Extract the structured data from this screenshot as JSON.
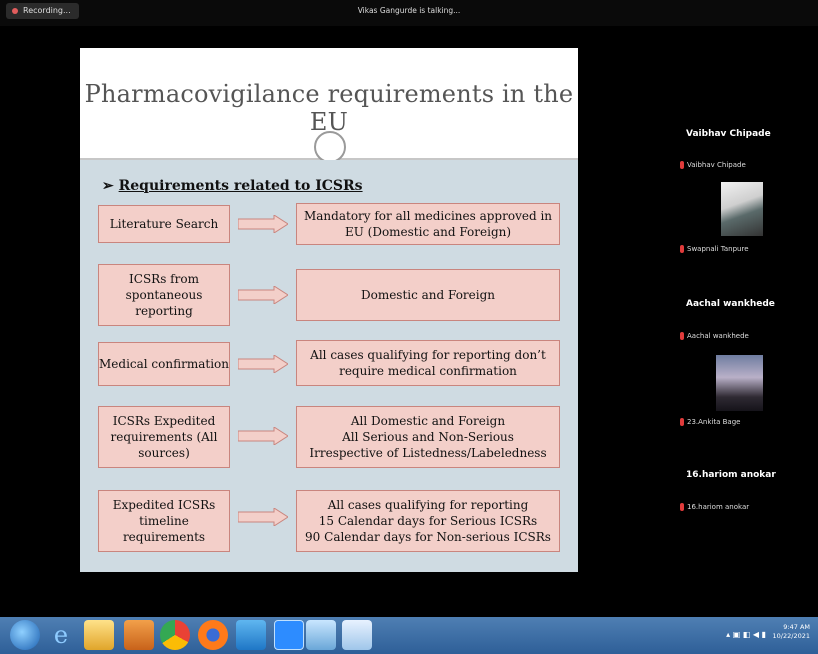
{
  "topbar": {
    "recording_label": "Recording...",
    "speaker_status": "Vikas Gangurde is talking..."
  },
  "slide": {
    "title": "Pharmacovigilance requirements in the EU",
    "subhead_marker": "➢",
    "subhead": "Requirements related to ICSRs",
    "rows": [
      {
        "left": "Literature Search",
        "right": "Mandatory for all medicines approved in EU (Domestic and Foreign)"
      },
      {
        "left": "ICSRs from spontaneous reporting",
        "right": "Domestic and Foreign"
      },
      {
        "left": "Medical confirmation",
        "right": "All cases qualifying for reporting don’t require medical confirmation"
      },
      {
        "left": "ICSRs Expedited requirements (All sources)",
        "right": "All Domestic and Foreign\nAll Serious and Non-Serious\nIrrespective of Listedness/Labeledness"
      },
      {
        "left": "Expedited ICSRs timeline requirements",
        "right": "All cases qualifying for reporting\n15 Calendar days for Serious ICSRs\n90 Calendar days for Non-serious ICSRs"
      }
    ]
  },
  "participants": {
    "p1_name": "Vaibhav Chipade",
    "p1_mic": "Vaibhav Chipade",
    "p2_mic": "Swapnali Tanpure",
    "p3_name": "Aachal wankhede",
    "p3_mic": "Aachal wankhede",
    "p4_mic": "23.Ankita Bage",
    "p5_name": "16.hariom anokar",
    "p5_mic": "16.hariom anokar"
  },
  "taskbar": {
    "time": "9:47 AM",
    "date": "10/22/2021",
    "apps": [
      "start-orb",
      "internet-explorer",
      "file-explorer",
      "office-app",
      "chrome",
      "firefox",
      "app-blue",
      "zoom",
      "screen-app",
      "paint-app"
    ]
  },
  "colors": {
    "box_fill": "#f3cfc9",
    "box_border": "#c9857e",
    "slide_body": "#cfdbe2",
    "taskbar": "#3a6aa3"
  }
}
